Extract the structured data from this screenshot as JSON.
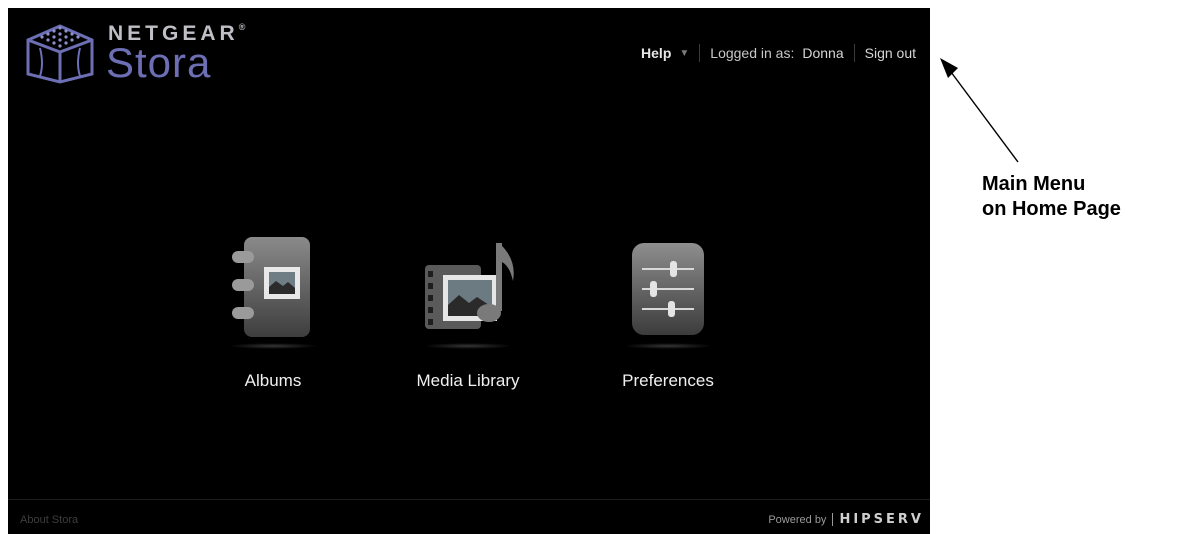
{
  "logo": {
    "brand": "NETGEAR",
    "product": "Stora"
  },
  "topnav": {
    "help_label": "Help",
    "logged_in_label": "Logged in as:",
    "username": "Donna",
    "signout_label": "Sign out"
  },
  "apps": [
    {
      "label": "Albums"
    },
    {
      "label": "Media Library"
    },
    {
      "label": "Preferences"
    }
  ],
  "footer": {
    "about_label": "About Stora",
    "powered_label": "Powered by",
    "powered_brand": "HIPSERV"
  },
  "annotation": {
    "line1": "Main Menu",
    "line2": "on Home Page"
  },
  "colors": {
    "accent": "#6d6fb4",
    "background": "#000000"
  }
}
